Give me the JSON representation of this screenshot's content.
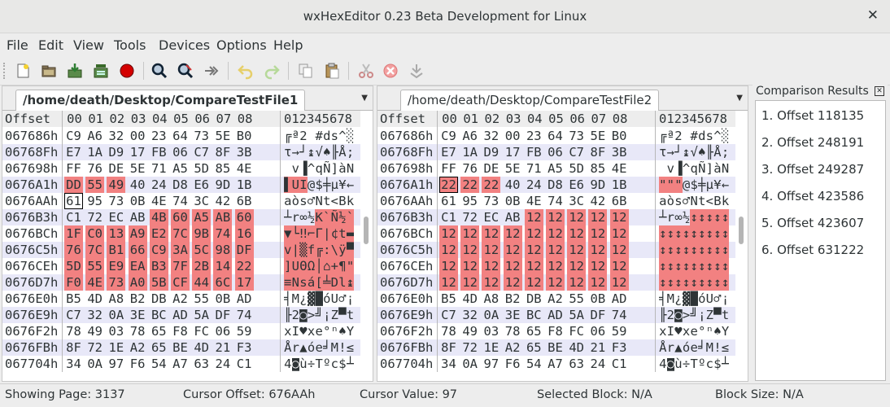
{
  "window": {
    "title": "wxHexEditor 0.23 Beta Development for Linux"
  },
  "menu": [
    "File",
    "Edit",
    "View",
    "Tools",
    "Devices",
    "Options",
    "Help"
  ],
  "toolbar_icons": [
    "new-file-icon",
    "open-file-icon",
    "save-icon",
    "save-as-icon",
    "record-icon",
    "find-icon",
    "find-replace-icon",
    "goto-icon",
    "undo-icon",
    "redo-icon",
    "copy-icon",
    "paste-icon",
    "cut-icon",
    "delete-icon",
    "insert-icon"
  ],
  "header": {
    "offset": "Offset",
    "cols": [
      "00",
      "01",
      "02",
      "03",
      "04",
      "05",
      "06",
      "07",
      "08"
    ],
    "ascii": "012345678"
  },
  "colors": {
    "highlight": "#f28181",
    "stripe": "#e8e8f8"
  },
  "file1": {
    "tab": "/home/death/Desktop/CompareTestFile1",
    "rows": [
      {
        "offset": "067686h",
        "bytes": [
          "C9",
          "A6",
          "32",
          "00",
          "23",
          "64",
          "73",
          "5E",
          "B0"
        ],
        "ascii": [
          "╔",
          "ª",
          "2",
          " ",
          "#",
          "d",
          "s",
          "^",
          "░"
        ],
        "hl": []
      },
      {
        "offset": "06768Fh",
        "bytes": [
          "E7",
          "1A",
          "D9",
          "17",
          "FB",
          "06",
          "C7",
          "8F",
          "3B"
        ],
        "ascii": [
          "τ",
          "→",
          "┘",
          "↨",
          "√",
          "♠",
          "╟",
          "Å",
          ";"
        ],
        "hl": []
      },
      {
        "offset": "067698h",
        "bytes": [
          "FF",
          "76",
          "DE",
          "5E",
          "71",
          "A5",
          "5D",
          "85",
          "4E"
        ],
        "ascii": [
          " ",
          "v",
          "▐",
          "^",
          "q",
          "Ñ",
          "]",
          "à",
          "N"
        ],
        "hl": []
      },
      {
        "offset": "0676A1h",
        "bytes": [
          "DD",
          "55",
          "49",
          "40",
          "24",
          "D8",
          "E6",
          "9D",
          "1B"
        ],
        "ascii": [
          "▌",
          "U",
          "I",
          "@",
          "$",
          "╪",
          "µ",
          "¥",
          "←"
        ],
        "hl": [
          0,
          1,
          2
        ]
      },
      {
        "offset": "0676AAh",
        "bytes": [
          "61",
          "95",
          "73",
          "0B",
          "4E",
          "74",
          "3C",
          "42",
          "6B"
        ],
        "ascii": [
          "a",
          "ò",
          "s",
          "♂",
          "N",
          "t",
          "<",
          "B",
          "k"
        ],
        "hl": [],
        "cursor": 0
      },
      {
        "offset": "0676B3h",
        "bytes": [
          "C1",
          "72",
          "EC",
          "AB",
          "4B",
          "60",
          "A5",
          "AB",
          "60"
        ],
        "ascii": [
          "┴",
          "r",
          "∞",
          "½",
          "K",
          "`",
          "Ñ",
          "½",
          "`"
        ],
        "hl": [
          4,
          5,
          6,
          7,
          8
        ]
      },
      {
        "offset": "0676BCh",
        "bytes": [
          "1F",
          "C0",
          "13",
          "A9",
          "E2",
          "7C",
          "9B",
          "74",
          "16"
        ],
        "ascii": [
          "▼",
          "└",
          "‼",
          "⌐",
          "Γ",
          "|",
          "¢",
          "t",
          "▬"
        ],
        "hl": [
          0,
          1,
          2,
          3,
          4,
          5,
          6,
          7,
          8
        ]
      },
      {
        "offset": "0676C5h",
        "bytes": [
          "76",
          "7C",
          "B1",
          "66",
          "C9",
          "3A",
          "5C",
          "98",
          "DF"
        ],
        "ascii": [
          "v",
          "|",
          "▒",
          "f",
          "╔",
          ":",
          "\\",
          "ÿ",
          "▀"
        ],
        "hl": [
          0,
          1,
          2,
          3,
          4,
          5,
          6,
          7,
          8
        ]
      },
      {
        "offset": "0676CEh",
        "bytes": [
          "5D",
          "55",
          "E9",
          "EA",
          "B3",
          "7F",
          "2B",
          "14",
          "22"
        ],
        "ascii": [
          "]",
          "U",
          "Θ",
          "Ω",
          "│",
          "⌂",
          "+",
          "¶",
          "\""
        ],
        "hl": [
          0,
          1,
          2,
          3,
          4,
          5,
          6,
          7,
          8
        ]
      },
      {
        "offset": "0676D7h",
        "bytes": [
          "F0",
          "4E",
          "73",
          "A0",
          "5B",
          "CF",
          "44",
          "6C",
          "17"
        ],
        "ascii": [
          "≡",
          "N",
          "s",
          "á",
          "[",
          "╧",
          "D",
          "l",
          "↨"
        ],
        "hl": [
          0,
          1,
          2,
          3,
          4,
          5,
          6,
          7,
          8
        ]
      },
      {
        "offset": "0676E0h",
        "bytes": [
          "B5",
          "4D",
          "A8",
          "B2",
          "DB",
          "A2",
          "55",
          "0B",
          "AD"
        ],
        "ascii": [
          "╡",
          "M",
          "¿",
          "▓",
          "█",
          "ó",
          "U",
          "♂",
          "¡"
        ],
        "hl": []
      },
      {
        "offset": "0676E9h",
        "bytes": [
          "C7",
          "32",
          "0A",
          "3E",
          "BC",
          "AD",
          "5A",
          "DF",
          "74"
        ],
        "ascii": [
          "╟",
          "2",
          "◙",
          ">",
          "╝",
          "¡",
          "Z",
          "▀",
          "t"
        ],
        "hl": []
      },
      {
        "offset": "0676F2h",
        "bytes": [
          "78",
          "49",
          "03",
          "78",
          "65",
          "F8",
          "FC",
          "06",
          "59"
        ],
        "ascii": [
          "x",
          "I",
          "♥",
          "x",
          "e",
          "°",
          "ⁿ",
          "♠",
          "Y"
        ],
        "hl": []
      },
      {
        "offset": "0676FBh",
        "bytes": [
          "8F",
          "72",
          "1E",
          "A2",
          "65",
          "BE",
          "4D",
          "21",
          "F3"
        ],
        "ascii": [
          "Å",
          "r",
          "▲",
          "ó",
          "e",
          "╛",
          "M",
          "!",
          "≤"
        ],
        "hl": []
      },
      {
        "offset": "067704h",
        "bytes": [
          "34",
          "0A",
          "97",
          "F6",
          "54",
          "A7",
          "63",
          "24",
          "C1"
        ],
        "ascii": [
          "4",
          "◙",
          "ù",
          "÷",
          "T",
          "º",
          "c",
          "$",
          "┴"
        ],
        "hl": []
      }
    ]
  },
  "file2": {
    "tab": "/home/death/Desktop/CompareTestFile2",
    "rows": [
      {
        "offset": "067686h",
        "bytes": [
          "C9",
          "A6",
          "32",
          "00",
          "23",
          "64",
          "73",
          "5E",
          "B0"
        ],
        "ascii": [
          "╔",
          "ª",
          "2",
          " ",
          "#",
          "d",
          "s",
          "^",
          "░"
        ],
        "hl": []
      },
      {
        "offset": "06768Fh",
        "bytes": [
          "E7",
          "1A",
          "D9",
          "17",
          "FB",
          "06",
          "C7",
          "8F",
          "3B"
        ],
        "ascii": [
          "τ",
          "→",
          "┘",
          "↨",
          "√",
          "♠",
          "╟",
          "Å",
          ";"
        ],
        "hl": []
      },
      {
        "offset": "067698h",
        "bytes": [
          "FF",
          "76",
          "DE",
          "5E",
          "71",
          "A5",
          "5D",
          "85",
          "4E"
        ],
        "ascii": [
          " ",
          "v",
          "▐",
          "^",
          "q",
          "Ñ",
          "]",
          "à",
          "N"
        ],
        "hl": []
      },
      {
        "offset": "0676A1h",
        "bytes": [
          "22",
          "22",
          "22",
          "40",
          "24",
          "D8",
          "E6",
          "9D",
          "1B"
        ],
        "ascii": [
          "\"",
          "\"",
          "\"",
          "@",
          "$",
          "╪",
          "µ",
          "¥",
          "←"
        ],
        "hl": [
          0,
          1,
          2
        ],
        "cursor": 0
      },
      {
        "offset": "0676AAh",
        "bytes": [
          "61",
          "95",
          "73",
          "0B",
          "4E",
          "74",
          "3C",
          "42",
          "6B"
        ],
        "ascii": [
          "a",
          "ò",
          "s",
          "♂",
          "N",
          "t",
          "<",
          "B",
          "k"
        ],
        "hl": []
      },
      {
        "offset": "0676B3h",
        "bytes": [
          "C1",
          "72",
          "EC",
          "AB",
          "12",
          "12",
          "12",
          "12",
          "12"
        ],
        "ascii": [
          "┴",
          "r",
          "∞",
          "½",
          "↕",
          "↕",
          "↕",
          "↕",
          "↕"
        ],
        "hl": [
          4,
          5,
          6,
          7,
          8
        ]
      },
      {
        "offset": "0676BCh",
        "bytes": [
          "12",
          "12",
          "12",
          "12",
          "12",
          "12",
          "12",
          "12",
          "12"
        ],
        "ascii": [
          "↕",
          "↕",
          "↕",
          "↕",
          "↕",
          "↕",
          "↕",
          "↕",
          "↕"
        ],
        "hl": [
          0,
          1,
          2,
          3,
          4,
          5,
          6,
          7,
          8
        ]
      },
      {
        "offset": "0676C5h",
        "bytes": [
          "12",
          "12",
          "12",
          "12",
          "12",
          "12",
          "12",
          "12",
          "12"
        ],
        "ascii": [
          "↕",
          "↕",
          "↕",
          "↕",
          "↕",
          "↕",
          "↕",
          "↕",
          "↕"
        ],
        "hl": [
          0,
          1,
          2,
          3,
          4,
          5,
          6,
          7,
          8
        ]
      },
      {
        "offset": "0676CEh",
        "bytes": [
          "12",
          "12",
          "12",
          "12",
          "12",
          "12",
          "12",
          "12",
          "12"
        ],
        "ascii": [
          "↕",
          "↕",
          "↕",
          "↕",
          "↕",
          "↕",
          "↕",
          "↕",
          "↕"
        ],
        "hl": [
          0,
          1,
          2,
          3,
          4,
          5,
          6,
          7,
          8
        ]
      },
      {
        "offset": "0676D7h",
        "bytes": [
          "12",
          "12",
          "12",
          "12",
          "12",
          "12",
          "12",
          "12",
          "12"
        ],
        "ascii": [
          "↕",
          "↕",
          "↕",
          "↕",
          "↕",
          "↕",
          "↕",
          "↕",
          "↕"
        ],
        "hl": [
          0,
          1,
          2,
          3,
          4,
          5,
          6,
          7,
          8
        ]
      },
      {
        "offset": "0676E0h",
        "bytes": [
          "B5",
          "4D",
          "A8",
          "B2",
          "DB",
          "A2",
          "55",
          "0B",
          "AD"
        ],
        "ascii": [
          "╡",
          "M",
          "¿",
          "▓",
          "█",
          "ó",
          "U",
          "♂",
          "¡"
        ],
        "hl": []
      },
      {
        "offset": "0676E9h",
        "bytes": [
          "C7",
          "32",
          "0A",
          "3E",
          "BC",
          "AD",
          "5A",
          "DF",
          "74"
        ],
        "ascii": [
          "╟",
          "2",
          "◙",
          ">",
          "╝",
          "¡",
          "Z",
          "▀",
          "t"
        ],
        "hl": []
      },
      {
        "offset": "0676F2h",
        "bytes": [
          "78",
          "49",
          "03",
          "78",
          "65",
          "F8",
          "FC",
          "06",
          "59"
        ],
        "ascii": [
          "x",
          "I",
          "♥",
          "x",
          "e",
          "°",
          "ⁿ",
          "♠",
          "Y"
        ],
        "hl": []
      },
      {
        "offset": "0676FBh",
        "bytes": [
          "8F",
          "72",
          "1E",
          "A2",
          "65",
          "BE",
          "4D",
          "21",
          "F3"
        ],
        "ascii": [
          "Å",
          "r",
          "▲",
          "ó",
          "e",
          "╛",
          "M",
          "!",
          "≤"
        ],
        "hl": []
      },
      {
        "offset": "067704h",
        "bytes": [
          "34",
          "0A",
          "97",
          "F6",
          "54",
          "A7",
          "63",
          "24",
          "C1"
        ],
        "ascii": [
          "4",
          "◙",
          "ù",
          "÷",
          "T",
          "º",
          "c",
          "$",
          "┴"
        ],
        "hl": []
      }
    ]
  },
  "results": {
    "title": "Comparison Results",
    "items": [
      "1. Offset 118135",
      "2. Offset 248191",
      "3. Offset 249287",
      "4. Offset 423586",
      "5. Offset 423607",
      "6. Offset 631222"
    ]
  },
  "status": {
    "page": "Showing Page: 3137",
    "cursor_offset": "Cursor Offset: 676AAh",
    "cursor_value": "Cursor Value: 97",
    "selected_block": "Selected Block: N/A",
    "block_size": "Block Size: N/A"
  }
}
